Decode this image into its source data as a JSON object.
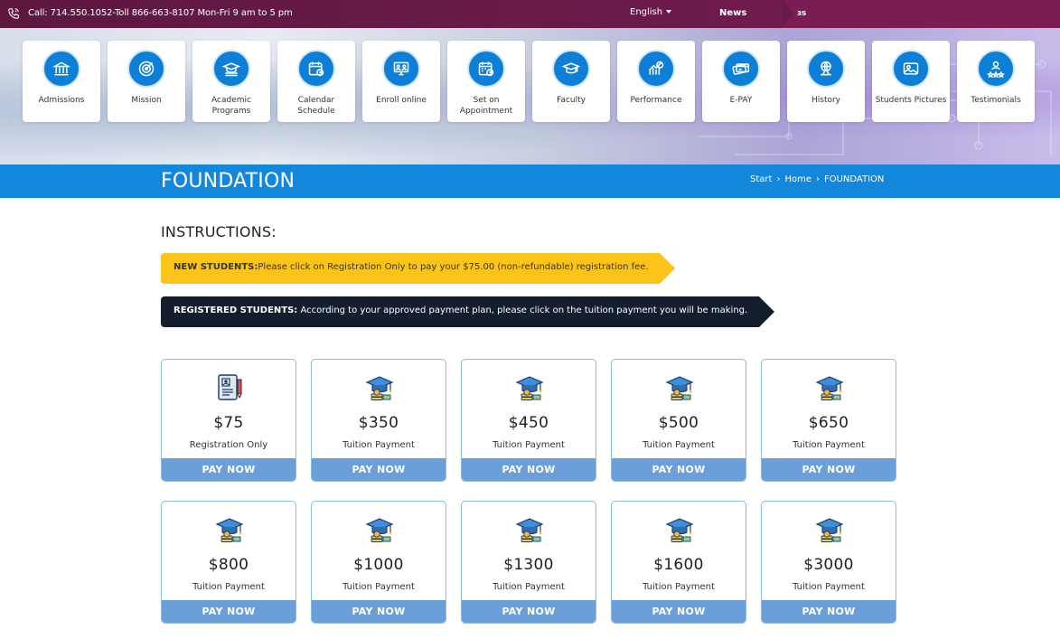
{
  "topbar": {
    "call_text": "Call: 714.550.1052-Toll 866-663-8107 Mon-Fri 9 am to 5 pm",
    "language": "English",
    "news_label": "News",
    "ticker_text": "ɜs",
    "phone_icon": "phone-icon"
  },
  "nav_tiles": [
    {
      "label": "Admissions",
      "icon": "institution-icon"
    },
    {
      "label": "Mission",
      "icon": "target-icon"
    },
    {
      "label": "Academic Programs",
      "icon": "graduation-cap-icon"
    },
    {
      "label": "Calendar Schedule",
      "icon": "calendar-clock-icon"
    },
    {
      "label": "Enroll online",
      "icon": "online-class-icon"
    },
    {
      "label": "Set on Appointment",
      "icon": "appointment-calendar-icon"
    },
    {
      "label": "Faculty",
      "icon": "faculty-cap-icon"
    },
    {
      "label": "Performance",
      "icon": "performance-chart-icon"
    },
    {
      "label": "E-PAY",
      "icon": "credit-card-icon"
    },
    {
      "label": "History",
      "icon": "globe-history-icon"
    },
    {
      "label": "Students Pictures",
      "icon": "photo-icon"
    },
    {
      "label": "Testimonials",
      "icon": "users-star-icon"
    }
  ],
  "page": {
    "title": "FOUNDATION",
    "breadcrumb": [
      "Start",
      "Home",
      "FOUNDATION"
    ]
  },
  "instructions": {
    "heading": "INSTRUCTIONS:",
    "new_students_label": "NEW STUDENTS:",
    "new_students_text": "Please click on Registration Only to pay your $75.00 (non-refundable) registration fee.",
    "registered_label": "REGISTERED STUDENTS:",
    "registered_text": " According to your approved payment plan, please click on the tuition payment you will be making."
  },
  "payments": [
    {
      "price": "$75",
      "desc": "Registration Only",
      "button": "PAY NOW",
      "icon": "registration-form-icon"
    },
    {
      "price": "$350",
      "desc": "Tuition Payment",
      "button": "PAY NOW",
      "icon": "graduation-money-icon"
    },
    {
      "price": "$450",
      "desc": "Tuition Payment",
      "button": "PAY NOW",
      "icon": "graduation-money-icon"
    },
    {
      "price": "$500",
      "desc": "Tuition Payment",
      "button": "PAY NOW",
      "icon": "graduation-money-icon"
    },
    {
      "price": "$650",
      "desc": "Tuition Payment",
      "button": "PAY NOW",
      "icon": "graduation-money-icon"
    },
    {
      "price": "$800",
      "desc": "Tuition Payment",
      "button": "PAY NOW",
      "icon": "graduation-money-icon"
    },
    {
      "price": "$1000",
      "desc": "Tuition Payment",
      "button": "PAY NOW",
      "icon": "graduation-money-icon"
    },
    {
      "price": "$1300",
      "desc": "Tuition Payment",
      "button": "PAY NOW",
      "icon": "graduation-money-icon"
    },
    {
      "price": "$1600",
      "desc": "Tuition Payment",
      "button": "PAY NOW",
      "icon": "graduation-money-icon"
    },
    {
      "price": "$3000",
      "desc": "Tuition Payment",
      "button": "PAY NOW",
      "icon": "graduation-money-icon"
    }
  ],
  "colors": {
    "topbar": "#6a1a4a",
    "accent_blue": "#1387dc",
    "pay_button": "#6a9fd9",
    "new_banner": "#fcc419",
    "registered_banner": "#141e2d"
  }
}
